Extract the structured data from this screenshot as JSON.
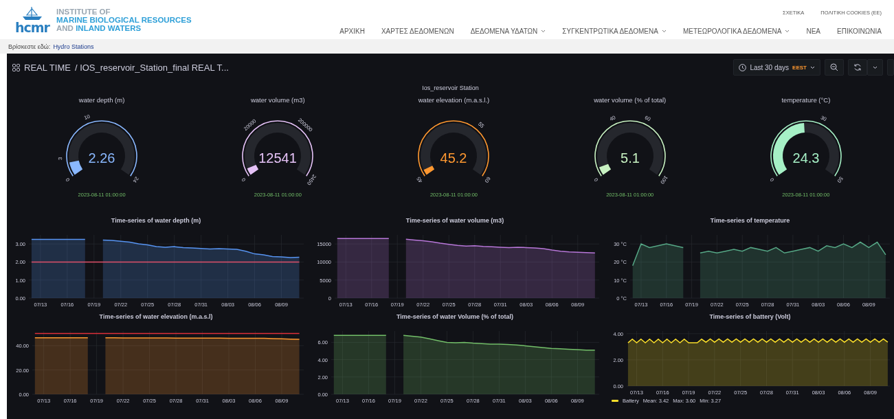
{
  "header": {
    "logo_text": "hcmr",
    "institute": [
      {
        "kind": "muted",
        "parts": [
          "INSTITUTE OF"
        ]
      },
      {
        "kind": "accent",
        "parts": [
          "MARINE BIOLOGICAL RESOURCES"
        ]
      },
      {
        "kind": "mixed",
        "parts": [
          "AND",
          "INLAND WATERS"
        ]
      }
    ],
    "top_links": [
      "ΣΧΕΤΙΚΑ",
      "ΠΟΛΙΤΙΚΗ COOKIES (ΕΕ)"
    ],
    "nav": [
      {
        "label": "ΑΡΧΙΚΗ",
        "has_dropdown": false
      },
      {
        "label": "ΧΑΡΤΕΣ ΔΕΔΟΜΕΝΩΝ",
        "has_dropdown": false
      },
      {
        "label": "ΔΕΔΟΜΕΝΑ ΥΔΑΤΩΝ",
        "has_dropdown": true
      },
      {
        "label": "ΣΥΓΚΕΝΤΡΩΤΙΚΑ ΔΕΔΟΜΕΝΑ",
        "has_dropdown": true
      },
      {
        "label": "ΜΕΤΕΩΡΟΛΟΓΙΚΑ ΔΕΔΟΜΕΝΑ",
        "has_dropdown": true
      },
      {
        "label": "ΝΕΑ",
        "has_dropdown": false
      },
      {
        "label": "ΕΠΙΚΟΙΝΩΝΙΑ",
        "has_dropdown": false
      }
    ]
  },
  "breadcrumb": {
    "prefix": "Βρίσκεστε εδώ:",
    "link": "Hydro Stations"
  },
  "dashboard": {
    "folder": "REAL TIME",
    "title": "/ IOS_reservoir_Station_final REAL T...",
    "time_range": "Last 30 days",
    "timezone": "EEST"
  },
  "station_title": "Ios_reservoir Station",
  "gauges": [
    {
      "title": "water depth (m)",
      "value": "2.26",
      "level": 0.094,
      "color": "#8ab8ff",
      "ticks": [
        "0",
        "3",
        "10",
        "24"
      ],
      "timestamp": "2023-08-11 01:00:00"
    },
    {
      "title": "water volume (m3)",
      "value": "12541",
      "level": 0.05,
      "color": "#e5c2f7",
      "ticks": [
        "0",
        "20000",
        "200000",
        "2450"
      ],
      "timestamp": "2023-08-11 01:00:00"
    },
    {
      "title": "water elevation (m.a.s.l.)",
      "value": "45.2",
      "level": 0.04,
      "color": "#ff9830",
      "ticks": [
        "45",
        "55",
        "60"
      ],
      "timestamp": "2023-08-11 01:00:00"
    },
    {
      "title": "water volume (% of total)",
      "value": "5.1",
      "level": 0.06,
      "color": "#c8f2c2",
      "ticks": [
        "0",
        "40",
        "60",
        "100"
      ],
      "timestamp": "2023-08-11 01:00:00"
    },
    {
      "title": "temperature (°C)",
      "value": "24.3",
      "level": 0.486,
      "color": "#a6f0c6",
      "ticks": [
        "0",
        "30",
        "50"
      ],
      "timestamp": "2023-08-11 01:00:00"
    }
  ],
  "panels": [
    {
      "chart_data": {
        "type": "area",
        "title": "Time-series of water depth (m)",
        "ylim": [
          0,
          3.5
        ],
        "categories": [
          null,
          "07/13",
          null,
          null,
          "07/16",
          null,
          null,
          "07/19",
          null,
          null,
          "07/22",
          null,
          null,
          "07/25",
          null,
          null,
          "07/28",
          null,
          null,
          "07/31",
          null,
          null,
          "08/03",
          null,
          null,
          "08/06",
          null,
          null,
          "08/09",
          null,
          null
        ],
        "yticks": [
          {
            "value": 0,
            "label": "0.00"
          },
          {
            "value": 1,
            "label": "1.00"
          },
          {
            "value": 2,
            "label": "2.00"
          },
          {
            "value": 3,
            "label": "3.00"
          }
        ],
        "series": [
          {
            "color": "#5794f2",
            "values": [
              3.25,
              3.25,
              3.25,
              3.25,
              3.25,
              3.25,
              3.25,
              null,
              3.22,
              3.2,
              3.15,
              3.1,
              3.0,
              2.95,
              2.85,
              2.82,
              2.85,
              2.8,
              2.78,
              2.75,
              2.72,
              2.74,
              2.72,
              2.7,
              2.6,
              2.45,
              2.4,
              2.3,
              2.28,
              2.25,
              2.26
            ]
          },
          {
            "type": "line",
            "color": "#e0506a",
            "values": [
              2,
              2,
              2,
              2,
              2,
              2,
              2,
              2,
              2,
              2,
              2,
              2,
              2,
              2,
              2,
              2,
              2,
              2,
              2,
              2,
              2,
              2,
              2,
              2,
              2,
              2,
              2,
              2,
              2,
              2,
              2
            ]
          }
        ],
        "grid": true
      }
    },
    {
      "chart_data": {
        "type": "area",
        "title": "Time-series of water volume (m3)",
        "ylim": [
          0,
          17500
        ],
        "categories": [
          null,
          "07/13",
          null,
          null,
          "07/16",
          null,
          null,
          "07/19",
          null,
          null,
          "07/22",
          null,
          null,
          "07/25",
          null,
          null,
          "07/28",
          null,
          null,
          "07/31",
          null,
          null,
          "08/03",
          null,
          null,
          "08/06",
          null,
          null,
          "08/09",
          null,
          null
        ],
        "yticks": [
          {
            "value": 0,
            "label": "0"
          },
          {
            "value": 5000,
            "label": "5000"
          },
          {
            "value": 10000,
            "label": "10000"
          },
          {
            "value": 15000,
            "label": "15000"
          }
        ],
        "grid": true,
        "series": [
          {
            "color": "#b877d9",
            "values": [
              16500,
              16500,
              16500,
              16500,
              16500,
              16500,
              16500,
              null,
              16300,
              16100,
              15900,
              15600,
              15200,
              14900,
              14600,
              14400,
              14500,
              14300,
              14200,
              14100,
              14000,
              14100,
              14000,
              13900,
              13700,
              13300,
              13000,
              12800,
              12700,
              12600,
              12500
            ]
          }
        ]
      }
    },
    {
      "chart_data": {
        "type": "area",
        "title": "Time-series of temperature",
        "ylim": [
          0,
          35
        ],
        "categories": [
          null,
          "07/13",
          null,
          null,
          "07/16",
          null,
          null,
          "07/19",
          null,
          null,
          "07/22",
          null,
          null,
          "07/25",
          null,
          null,
          "07/28",
          null,
          null,
          "07/31",
          null,
          null,
          "08/03",
          null,
          null,
          "08/06",
          null,
          null,
          "08/09",
          null,
          null
        ],
        "yticks": [
          {
            "value": 0,
            "label": "0 °C"
          },
          {
            "value": 10,
            "label": "10 °C"
          },
          {
            "value": 20,
            "label": "20 °C"
          },
          {
            "value": 30,
            "label": "30 °C"
          }
        ],
        "grid": true,
        "series": [
          {
            "color": "#56a886",
            "values": [
              18,
              30,
              28,
              29,
              30,
              29,
              28,
              null,
              25,
              26,
              25,
              26,
              27,
              26,
              28,
              27,
              26,
              28,
              25,
              26,
              27,
              28,
              26,
              29,
              28,
              30,
              28,
              31,
              28,
              31,
              24
            ]
          }
        ]
      }
    },
    {
      "chart_data": {
        "type": "area",
        "title": "Time-series of water elevation (m.a.s.l)",
        "ylim": [
          0,
          52
        ],
        "categories": [
          null,
          "07/13",
          null,
          null,
          "07/16",
          null,
          null,
          "07/19",
          null,
          null,
          "07/22",
          null,
          null,
          "07/25",
          null,
          null,
          "07/28",
          null,
          null,
          "07/31",
          null,
          null,
          "08/03",
          null,
          null,
          "08/06",
          null,
          null,
          "08/09",
          null,
          null
        ],
        "yticks": [
          {
            "value": 0,
            "label": "0.00"
          },
          {
            "value": 20,
            "label": "20.00"
          },
          {
            "value": 40,
            "label": "40.00"
          }
        ],
        "series": [
          {
            "color": "#ff9830",
            "values": [
              46.5,
              46.5,
              46.5,
              46.5,
              46.5,
              46.5,
              46.5,
              null,
              46.5,
              46.5,
              46.4,
              46.4,
              46.4,
              46.4,
              46.4,
              46.4,
              46.2,
              46.2,
              46.2,
              46.2,
              46.2,
              46.2,
              46.0,
              46.0,
              46.0,
              46.0,
              46.0,
              45.8,
              45.6,
              45.4,
              45.2
            ]
          },
          {
            "type": "line",
            "color": "#e0303a",
            "values": [
              50,
              50,
              50,
              50,
              50,
              50,
              50,
              50,
              50,
              50,
              50,
              50,
              50,
              50,
              50,
              50,
              50,
              50,
              50,
              50,
              50,
              50,
              50,
              50,
              50,
              50,
              50,
              50,
              50,
              50,
              50
            ]
          }
        ],
        "grid": true
      }
    },
    {
      "chart_data": {
        "type": "area",
        "title": "Time-series of water Volume (% of total)",
        "ylim": [
          0,
          7.3
        ],
        "categories": [
          null,
          "07/13",
          null,
          null,
          "07/16",
          null,
          null,
          "07/19",
          null,
          null,
          "07/22",
          null,
          null,
          "07/25",
          null,
          null,
          "07/28",
          null,
          null,
          "07/31",
          null,
          null,
          "08/03",
          null,
          null,
          "08/06",
          null,
          null,
          "08/09",
          null,
          null
        ],
        "yticks": [
          {
            "value": 0,
            "label": "0.00"
          },
          {
            "value": 2,
            "label": "2.00"
          },
          {
            "value": 4,
            "label": "4.00"
          },
          {
            "value": 6,
            "label": "6.00"
          }
        ],
        "grid": true,
        "series": [
          {
            "color": "#73bf69",
            "values": [
              6.8,
              6.8,
              6.8,
              6.8,
              6.8,
              6.8,
              6.8,
              null,
              6.8,
              6.7,
              6.6,
              6.4,
              6.2,
              6.0,
              5.95,
              6.0,
              5.9,
              5.85,
              5.8,
              5.8,
              5.75,
              5.7,
              5.6,
              5.5,
              5.4,
              5.3,
              5.25,
              5.2,
              5.15,
              5.1,
              5.1
            ]
          }
        ]
      }
    },
    {
      "chart_data": {
        "type": "area",
        "title": "Time-series of battery (Volt)",
        "ylim": [
          0,
          4.2
        ],
        "categories": [
          null,
          null,
          "07/13",
          null,
          null,
          null,
          null,
          null,
          "07/16",
          null,
          null,
          null,
          null,
          null,
          "07/19",
          null,
          null,
          null,
          null,
          null,
          "07/22",
          null,
          null,
          null,
          null,
          null,
          "07/25",
          null,
          null,
          null,
          null,
          null,
          "07/28",
          null,
          null,
          null,
          null,
          null,
          "07/31",
          null,
          null,
          null,
          null,
          null,
          "08/03",
          null,
          null,
          null,
          null,
          null,
          "08/06",
          null,
          null,
          null,
          null,
          null,
          "08/09",
          null,
          null,
          null,
          null
        ],
        "yticks": [
          {
            "value": 0,
            "label": "0.00"
          },
          {
            "value": 2,
            "label": "2.00"
          },
          {
            "value": 4,
            "label": "4.00"
          }
        ],
        "grid": true,
        "series": [
          {
            "name": "Battery",
            "color": "#fade2a",
            "values": [
              3.3,
              3.58,
              3.3,
              3.58,
              3.3,
              3.58,
              3.3,
              3.58,
              3.3,
              3.58,
              3.3,
              3.58,
              3.3,
              3.58,
              3.3,
              3.3,
              3.3,
              3.58,
              3.35,
              3.6,
              3.35,
              3.6,
              3.35,
              3.6,
              3.35,
              3.6,
              3.35,
              3.6,
              3.35,
              3.6,
              3.35,
              3.6,
              3.35,
              3.6,
              3.35,
              3.6,
              3.35,
              3.6,
              3.35,
              3.6,
              3.35,
              3.6,
              3.35,
              3.6,
              3.35,
              3.6,
              3.35,
              3.6,
              3.35,
              3.6,
              3.35,
              3.6,
              3.35,
              3.6,
              3.35,
              3.6,
              3.35,
              3.6,
              3.35,
              3.6,
              3.35
            ]
          }
        ]
      },
      "legend_stats": [
        "Mean: 3.42",
        "Max: 3.60",
        "Min: 3.27"
      ]
    }
  ]
}
